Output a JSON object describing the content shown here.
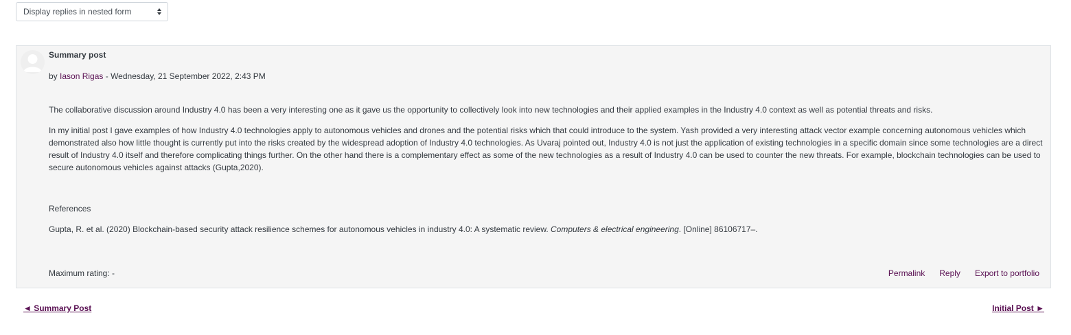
{
  "display_mode": {
    "selected": "Display replies in nested form"
  },
  "post": {
    "subject": "Summary post",
    "by_prefix": "by ",
    "author": "Iason Rigas",
    "date_separator": " - ",
    "date": "Wednesday, 21 September 2022, 2:43 PM",
    "paragraph1": "The collaborative discussion around Industry 4.0 has been a very interesting one as it gave us the opportunity to collectively look into new technologies and their applied examples in the Industry 4.0 context as well as potential threats and risks.",
    "paragraph2": "In my initial post I gave examples of how Industry 4.0 technologies apply to autonomous vehicles and drones and the potential risks which that could introduce to the system. Yash provided a very interesting attack vector example concerning autonomous vehicles which demonstrated also how little thought is currently put into the risks created by the widespread adoption of Industry 4.0 technologies. As Uvaraj pointed out, Industry 4.0 is not just the application of existing technologies in a specific domain since some technologies are a direct result of Industry 4.0 itself and therefore complicating things further. On the other hand there is a complementary effect as some of the new technologies as a result of Industry 4.0 can be used to counter the new threats. For example, blockchain technologies can be used to secure autonomous vehicles against attacks (Gupta,2020).",
    "references_heading": "References",
    "reference_prefix": "Gupta, R. et al. (2020) Blockchain-based security attack resilience schemes for autonomous vehicles in industry 4.0: A systematic review. ",
    "reference_journal": "Computers & electrical engineering",
    "reference_suffix": ". [Online] 86106717–.",
    "rating": "Maximum rating: -",
    "commands": {
      "permalink": "Permalink",
      "reply": "Reply",
      "export": "Export to portfolio"
    }
  },
  "navigation": {
    "prev": "◄ Summary Post",
    "next": "Initial Post ►"
  },
  "colors": {
    "link": "#5a1153",
    "post_background": "#f5f5f5",
    "border": "#dee2e6"
  }
}
